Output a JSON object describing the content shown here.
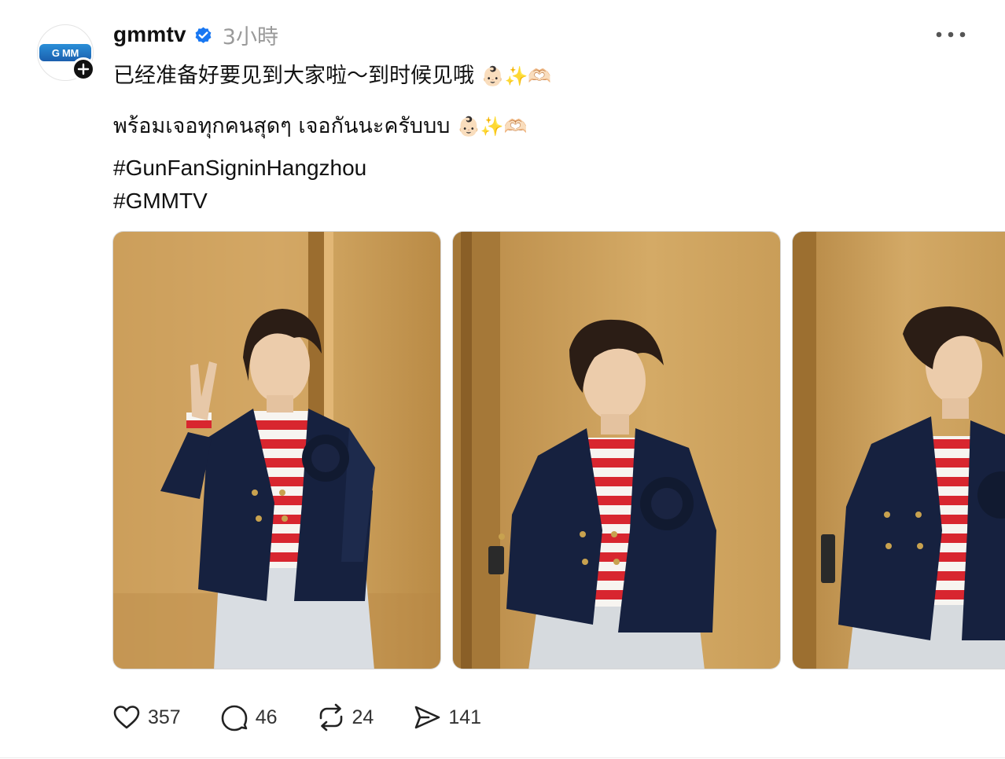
{
  "post": {
    "username": "gmmtv",
    "time": "3小時",
    "avatar_text": "G MM",
    "line_1": "已经准备好要见到大家啦～到时候见哦",
    "line_1_emoji": "👶🏻✨🫶🏻",
    "line_2": "พร้อมเจอทุกคนสุดๆ เจอกันนะครับบบ",
    "line_2_emoji": "👶🏻✨🫶🏻",
    "hashtags": [
      "#GunFanSigninHangzhou",
      "#GMMTV"
    ],
    "image_count": 3
  },
  "actions": {
    "likes": "357",
    "comments": "46",
    "reposts": "24",
    "shares": "141"
  },
  "icons": {
    "verified": "verified-badge-icon",
    "more": "more-dots-icon",
    "like": "heart-icon",
    "comment": "comment-icon",
    "repost": "repost-icon",
    "share": "send-icon",
    "follow": "plus-icon"
  },
  "colors": {
    "verified_blue": "#1877f2",
    "text": "#111111",
    "muted": "#9a9a9a",
    "brand_logo": "#1b5fae"
  }
}
